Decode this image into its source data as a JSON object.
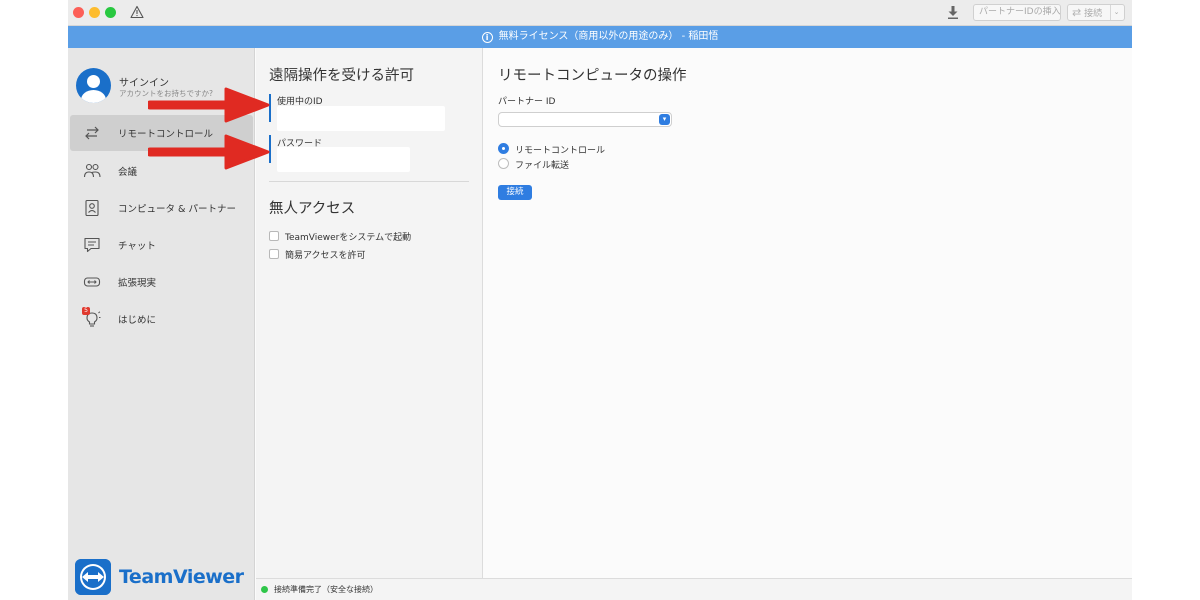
{
  "titlebar": {
    "partner_id_placeholder": "パートナーIDの挿入",
    "connect_label": "接続",
    "caret": "⌄"
  },
  "banner": {
    "text": "無料ライセンス（商用以外の用途のみ） - 稲田悟",
    "icon": "i"
  },
  "sidebar": {
    "signin_title": "サインイン",
    "signin_subtitle": "アカウントをお持ちですか?",
    "items": [
      {
        "label": "リモートコントロール",
        "icon": "arrows-swap-icon",
        "active": true
      },
      {
        "label": "会議",
        "icon": "people-icon",
        "active": false
      },
      {
        "label": "コンピュータ & パートナー",
        "icon": "contact-card-icon",
        "active": false
      },
      {
        "label": "チャット",
        "icon": "chat-icon",
        "active": false
      },
      {
        "label": "拡張現実",
        "icon": "ar-headset-icon",
        "active": false
      },
      {
        "label": "はじめに",
        "icon": "lightbulb-icon",
        "active": false,
        "badge": "5"
      }
    ],
    "logo_text": "TeamViewer"
  },
  "allow": {
    "title": "遠隔操作を受ける許可",
    "id_label": "使用中のID",
    "id_value": "",
    "password_label": "パスワード",
    "password_value": ""
  },
  "unattended": {
    "title": "無人アクセス",
    "options": [
      {
        "label": "TeamViewerをシステムで起動",
        "checked": false
      },
      {
        "label": "簡易アクセスを許可",
        "checked": false
      }
    ]
  },
  "remote": {
    "title": "リモートコンピュータの操作",
    "partner_label": "パートナー ID",
    "partner_value": "",
    "modes": [
      {
        "label": "リモートコントロール",
        "selected": true
      },
      {
        "label": "ファイル転送",
        "selected": false
      }
    ],
    "connect_button": "接続"
  },
  "status": {
    "text": "接続準備完了（安全な接続）",
    "color": "#2fc64a"
  },
  "colors": {
    "accent": "#1a6fc9",
    "banner": "#5a9ee6",
    "annotation_arrow": "#e02a22"
  }
}
